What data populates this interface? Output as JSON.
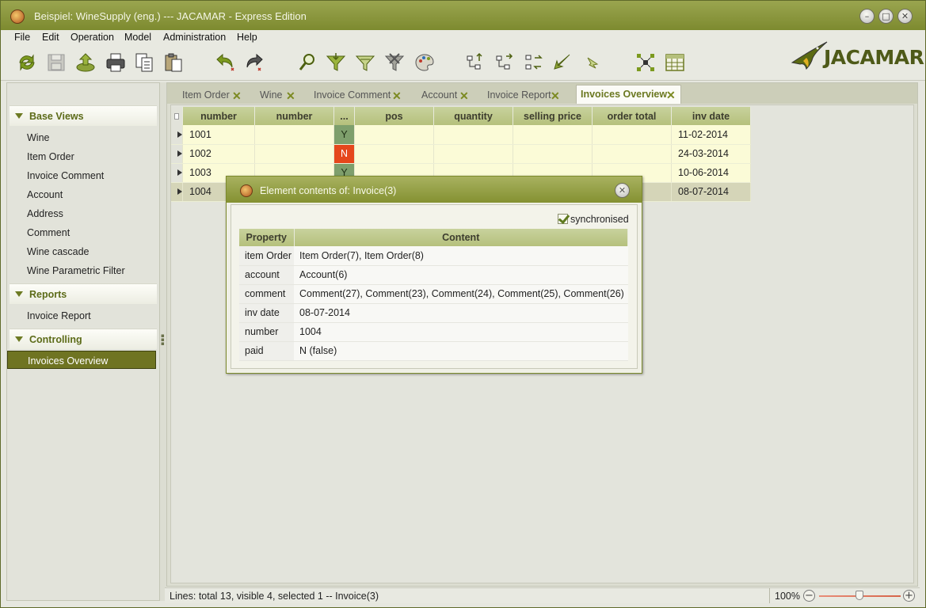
{
  "window": {
    "title": "Beispiel: WineSupply (eng.) --- JACAMAR - Express Edition"
  },
  "menu": [
    "File",
    "Edit",
    "Operation",
    "Model",
    "Administration",
    "Help"
  ],
  "toolbar": {
    "icons": [
      "refresh-icon",
      "save-icon",
      "export-icon",
      "print-icon",
      "copy-icon",
      "paste-icon",
      "undo-icon",
      "redo-icon",
      "search-icon",
      "filter-icon",
      "filter-edit-icon",
      "filter-clear-icon",
      "palette-icon",
      "tree-up-icon",
      "tree-swap-icon",
      "tree-move-icon",
      "arrow-down-left-icon",
      "arrow-down-right-icon",
      "network-icon",
      "table-view-icon"
    ]
  },
  "logo": {
    "text": "JACAMAR"
  },
  "sidebar": {
    "sections": [
      {
        "label": "Base Views",
        "items": [
          "Wine",
          "Item Order",
          "Invoice Comment",
          "Account",
          "Address",
          "Comment",
          "Wine cascade",
          "Wine Parametric Filter"
        ]
      },
      {
        "label": "Reports",
        "items": [
          "Invoice Report"
        ]
      },
      {
        "label": "Controlling",
        "items": [
          "Invoices Overview"
        ]
      }
    ],
    "selected": "Invoices Overview"
  },
  "tabs": [
    "Item Order",
    "Wine",
    "Invoice Comment",
    "Account",
    "Invoice Report",
    "Invoices Overview"
  ],
  "active_tab": "Invoices Overview",
  "grid": {
    "columns": [
      "number",
      "number",
      "...",
      "pos",
      "quantity",
      "selling price",
      "order total",
      "inv date"
    ],
    "rows": [
      {
        "number": "1001",
        "flag": "Y",
        "date": "11-02-2014"
      },
      {
        "number": "1002",
        "flag": "N",
        "date": "24-03-2014"
      },
      {
        "number": "1003",
        "flag": "Y",
        "date": "10-06-2014"
      },
      {
        "number": "1004",
        "flag": "",
        "date": "08-07-2014"
      }
    ]
  },
  "popup": {
    "title": "Element contents of: Invoice(3)",
    "synchronised_label": "synchronised",
    "synchronised": true,
    "headers": [
      "Property",
      "Content"
    ],
    "rows": [
      {
        "property": "item Order",
        "content": "Item Order(7), Item Order(8)"
      },
      {
        "property": "account",
        "content": "Account(6)"
      },
      {
        "property": "comment",
        "content": "Comment(27), Comment(23), Comment(24), Comment(25), Comment(26)"
      },
      {
        "property": "inv date",
        "content": "08-07-2014"
      },
      {
        "property": "number",
        "content": "1004"
      },
      {
        "property": "paid",
        "content": "N (false)"
      }
    ]
  },
  "status": {
    "text": "Lines: total 13, visible 4, selected 1  -- Invoice(3)",
    "zoom": "100%",
    "zoom_level": 0.5
  },
  "colors": {
    "accent": "#7d8a2f",
    "selected": "#6f7422",
    "flag_yes": "#7e9f6c",
    "flag_no": "#e5471c",
    "row_bg": "#fbfbd7"
  }
}
